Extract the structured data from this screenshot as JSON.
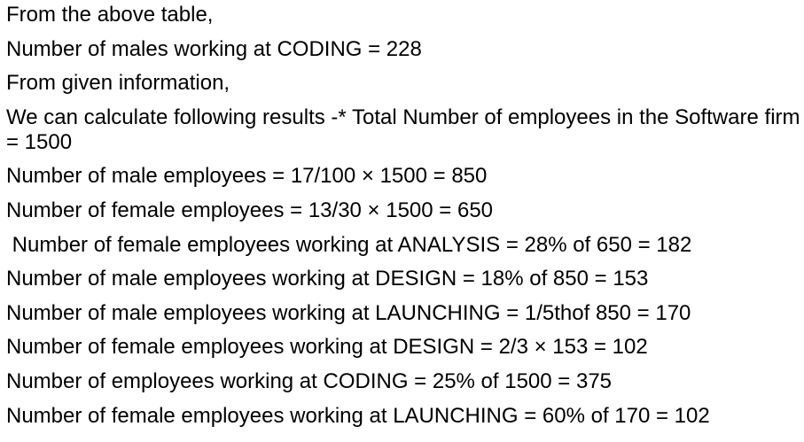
{
  "lines": [
    "From the above table,",
    "Number of males working at CODING = 228",
    "From given information,",
    "We can calculate following results -* Total Number of employees in the Software firm = 1500",
    "Number of male employees = 17/100 × 1500 = 850",
    "Number of female employees = 13/30 × 1500 = 650",
    " Number of female employees working at ANALYSIS = 28% of 650 = 182",
    "Number of male employees working at DESIGN = 18% of 850 = 153",
    "Number of male employees working at LAUNCHING = 1/5thof 850 = 170",
    "Number of female employees working at DESIGN = 2/3 × 153 = 102",
    "Number of employees working at CODING = 25% of 1500 = 375",
    "Number of female employees working at LAUNCHING = 60% of 170 = 102"
  ]
}
